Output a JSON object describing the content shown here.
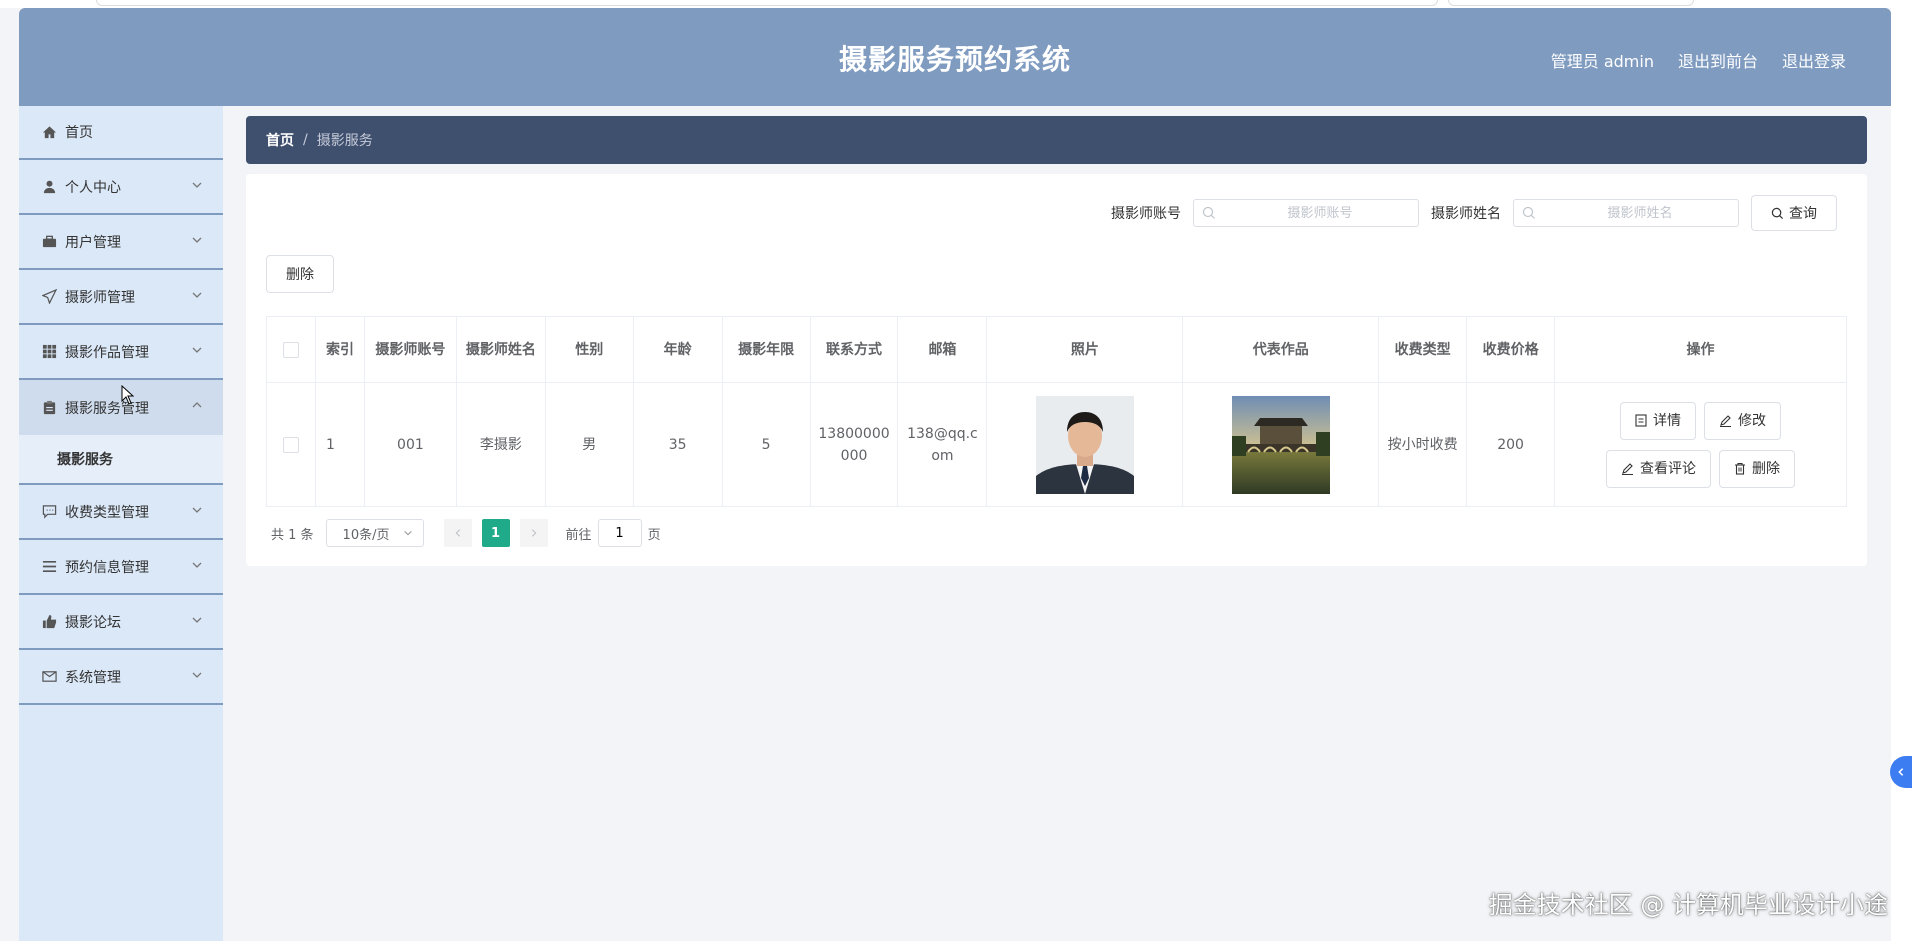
{
  "header": {
    "title": "摄影服务预约系统",
    "admin": "管理员 admin",
    "to_front": "退出到前台",
    "logout": "退出登录"
  },
  "sidebar": {
    "items": [
      {
        "label": "首页",
        "icon": "home-icon"
      },
      {
        "label": "个人中心",
        "icon": "user-icon"
      },
      {
        "label": "用户管理",
        "icon": "briefcase-icon"
      },
      {
        "label": "摄影师管理",
        "icon": "send-icon"
      },
      {
        "label": "摄影作品管理",
        "icon": "grid-icon"
      },
      {
        "label": "摄影服务管理",
        "icon": "clipboard-icon"
      },
      {
        "label": "收费类型管理",
        "icon": "chat-icon"
      },
      {
        "label": "预约信息管理",
        "icon": "list-icon"
      },
      {
        "label": "摄影论坛",
        "icon": "thumb-icon"
      },
      {
        "label": "系统管理",
        "icon": "mail-icon"
      }
    ],
    "sub_item": "摄影服务"
  },
  "breadcrumb": {
    "home": "首页",
    "separator": "/",
    "current": "摄影服务"
  },
  "search": {
    "account_label": "摄影师账号",
    "account_placeholder": "摄影师账号",
    "name_label": "摄影师姓名",
    "name_placeholder": "摄影师姓名",
    "query_button": "查询"
  },
  "toolbar": {
    "delete_button": "删除"
  },
  "table": {
    "headers": [
      "索引",
      "摄影师账号",
      "摄影师姓名",
      "性别",
      "年龄",
      "摄影年限",
      "联系方式",
      "邮箱",
      "照片",
      "代表作品",
      "收费类型",
      "收费价格",
      "操作"
    ],
    "rows": [
      {
        "index": "1",
        "account": "001",
        "name": "李摄影",
        "gender": "男",
        "age": "35",
        "years": "5",
        "phone": "13800000000",
        "email": "138@qq.com",
        "fee_type": "按小时收费",
        "price": "200"
      }
    ],
    "actions": {
      "detail": "详情",
      "edit": "修改",
      "comments": "查看评论",
      "delete": "删除"
    }
  },
  "pagination": {
    "total": "共 1 条",
    "page_size": "10条/页",
    "current_page": "1",
    "goto_prefix": "前往",
    "goto_value": "1",
    "goto_suffix": "页"
  },
  "watermark": "掘金技术社区 @ 计算机毕业设计小途",
  "colors": {
    "header_bg": "#7f9bc0",
    "sidebar_bg": "#dbe8f8",
    "breadcrumb_bg": "#3f4f6e",
    "pager_active": "#1fab89",
    "side_tab": "#3d7df2"
  }
}
